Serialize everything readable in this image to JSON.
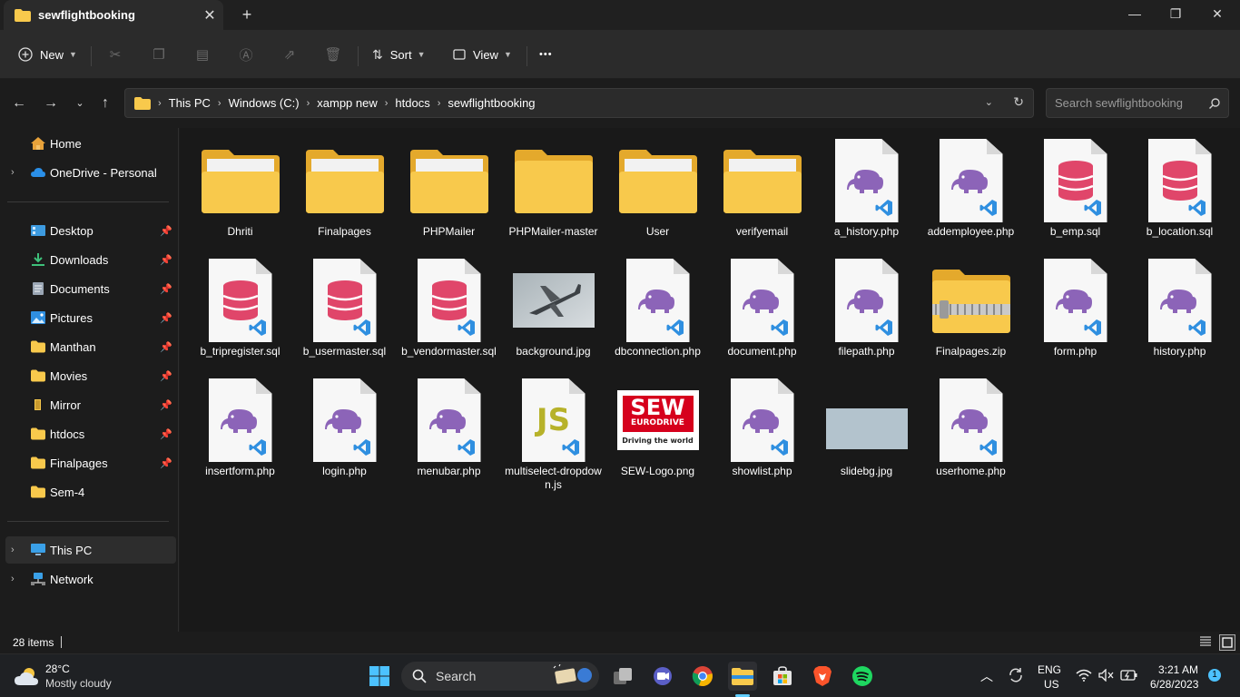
{
  "window": {
    "tab_title": "sewflightbooking",
    "tab_close": "✕",
    "new_tab": "+",
    "minimize": "—",
    "maximize": "❐",
    "close": "✕"
  },
  "toolbar": {
    "new_label": "New",
    "sort_label": "Sort",
    "view_label": "View",
    "more_label": "•••"
  },
  "address": {
    "breadcrumbs": [
      "This PC",
      "Windows (C:)",
      "xampp new",
      "htdocs",
      "sewflightbooking"
    ],
    "search_placeholder": "Search sewflightbooking"
  },
  "sidebar": {
    "items": [
      {
        "label": "Home"
      },
      {
        "label": "OneDrive - Personal"
      },
      {
        "label": "Desktop"
      },
      {
        "label": "Downloads"
      },
      {
        "label": "Documents"
      },
      {
        "label": "Pictures"
      },
      {
        "label": "Manthan"
      },
      {
        "label": "Movies"
      },
      {
        "label": "Mirror"
      },
      {
        "label": "htdocs"
      },
      {
        "label": "Finalpages"
      },
      {
        "label": "Sem-4"
      },
      {
        "label": "This PC"
      },
      {
        "label": "Network"
      }
    ]
  },
  "files": [
    {
      "name": "Dhriti",
      "kind": "folder"
    },
    {
      "name": "Finalpages",
      "kind": "folder"
    },
    {
      "name": "PHPMailer",
      "kind": "folder"
    },
    {
      "name": "PHPMailer-master",
      "kind": "folder"
    },
    {
      "name": "User",
      "kind": "folder"
    },
    {
      "name": "verifyemail",
      "kind": "folder"
    },
    {
      "name": "a_history.php",
      "kind": "php"
    },
    {
      "name": "addemployee.php",
      "kind": "php"
    },
    {
      "name": "b_emp.sql",
      "kind": "sql"
    },
    {
      "name": "b_location.sql",
      "kind": "sql"
    },
    {
      "name": "b_tripregister.sql",
      "kind": "sql"
    },
    {
      "name": "b_usermaster.sql",
      "kind": "sql"
    },
    {
      "name": "b_vendormaster.sql",
      "kind": "sql"
    },
    {
      "name": "background.jpg",
      "kind": "image-plane"
    },
    {
      "name": "dbconnection.php",
      "kind": "php"
    },
    {
      "name": "document.php",
      "kind": "php"
    },
    {
      "name": "filepath.php",
      "kind": "php"
    },
    {
      "name": "Finalpages.zip",
      "kind": "zip"
    },
    {
      "name": "form.php",
      "kind": "php"
    },
    {
      "name": "history.php",
      "kind": "php"
    },
    {
      "name": "insertform.php",
      "kind": "php"
    },
    {
      "name": "login.php",
      "kind": "php"
    },
    {
      "name": "menubar.php",
      "kind": "php"
    },
    {
      "name": "multiselect-dropdown.js",
      "kind": "js"
    },
    {
      "name": "SEW-Logo.png",
      "kind": "image-sew"
    },
    {
      "name": "showlist.php",
      "kind": "php"
    },
    {
      "name": "slidebg.jpg",
      "kind": "image-slide"
    },
    {
      "name": "userhome.php",
      "kind": "php"
    }
  ],
  "thumbnails": {
    "js_glyph": "JS",
    "sew_logo_line1": "SEW",
    "sew_logo_line2": "EURODRIVE",
    "sew_logo_line3": "Driving the world"
  },
  "status": {
    "item_count": "28 items"
  },
  "taskbar": {
    "weather_temp": "28°C",
    "weather_desc": "Mostly cloudy",
    "search_label": "Search",
    "language": "ENG",
    "region": "US",
    "time": "3:21 AM",
    "date": "6/28/2023",
    "notification_count": "1"
  },
  "colors": {
    "folder": "#f8c94c",
    "php_elephant": "#8c64b8",
    "sql_db": "#e0466a",
    "vscode_blue": "#2f8fe0",
    "accent": "#60cdff"
  }
}
